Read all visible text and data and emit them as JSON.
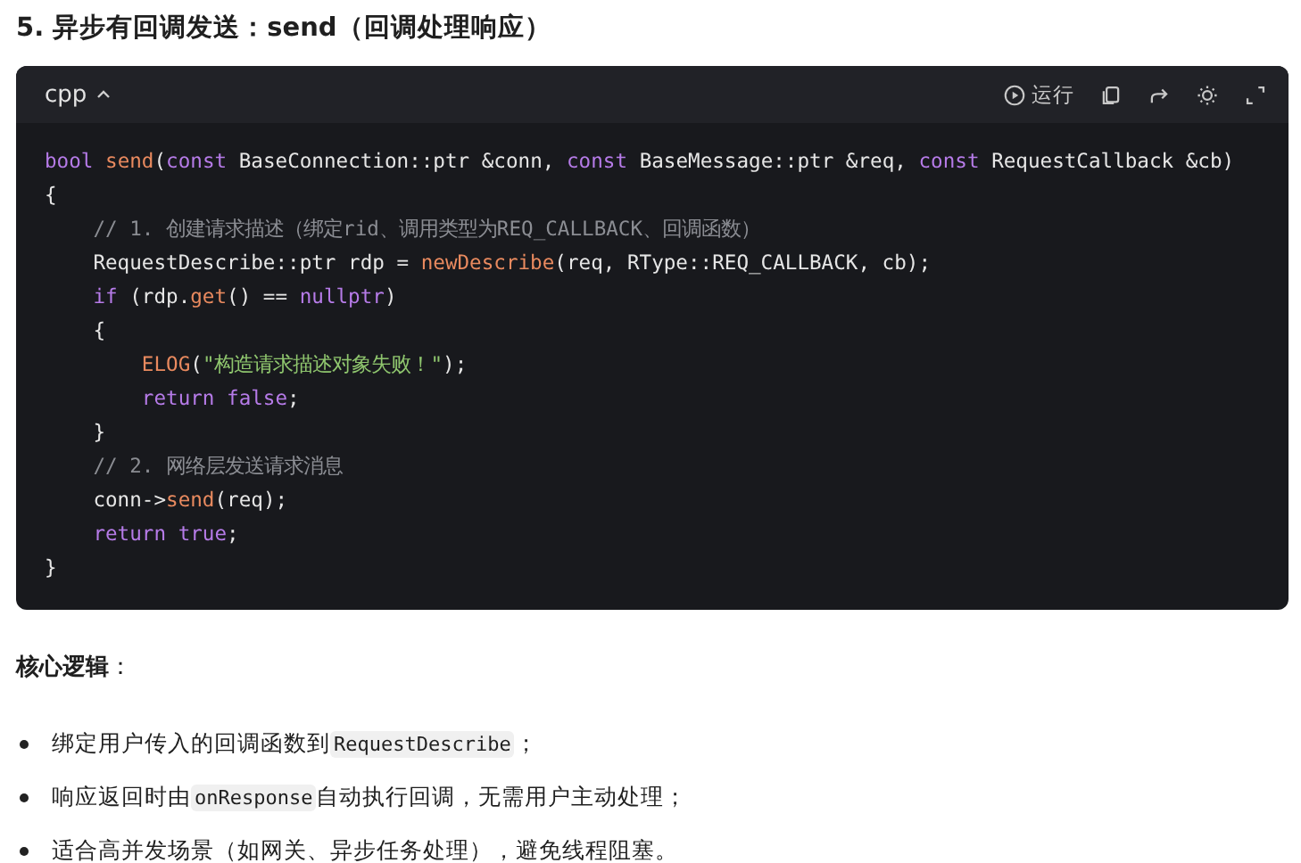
{
  "heading": "5. 异步有回调发送：send（回调处理响应）",
  "code_block": {
    "language": "cpp",
    "run_label": "运行",
    "lines": [
      [
        {
          "kind": "keyword",
          "text": "bool "
        },
        {
          "kind": "function",
          "text": "send"
        },
        {
          "kind": "plain",
          "text": "("
        },
        {
          "kind": "keyword",
          "text": "const "
        },
        {
          "kind": "plain",
          "text": "BaseConnection::ptr &conn, "
        },
        {
          "kind": "keyword",
          "text": "const "
        },
        {
          "kind": "plain",
          "text": "BaseMessage::ptr &req, "
        },
        {
          "kind": "keyword",
          "text": "const "
        },
        {
          "kind": "plain",
          "text": "RequestCallback &cb)"
        }
      ],
      [
        {
          "kind": "plain",
          "text": "{"
        }
      ],
      [
        {
          "kind": "comment",
          "text": "    // 1. 创建请求描述（绑定rid、调用类型为REQ_CALLBACK、回调函数）"
        }
      ],
      [
        {
          "kind": "plain",
          "text": "    RequestDescribe::ptr rdp = "
        },
        {
          "kind": "function",
          "text": "newDescribe"
        },
        {
          "kind": "plain",
          "text": "(req, RType::REQ_CALLBACK, cb);"
        }
      ],
      [
        {
          "kind": "keyword",
          "text": "    if "
        },
        {
          "kind": "plain",
          "text": "(rdp."
        },
        {
          "kind": "function",
          "text": "get"
        },
        {
          "kind": "plain",
          "text": "() == "
        },
        {
          "kind": "keyword",
          "text": "nullptr"
        },
        {
          "kind": "plain",
          "text": ")"
        }
      ],
      [
        {
          "kind": "plain",
          "text": "    {"
        }
      ],
      [
        {
          "kind": "function",
          "text": "        ELOG"
        },
        {
          "kind": "plain",
          "text": "("
        },
        {
          "kind": "string",
          "text": "\"构造请求描述对象失败！\""
        },
        {
          "kind": "plain",
          "text": ");"
        }
      ],
      [
        {
          "kind": "keyword",
          "text": "        return false"
        },
        {
          "kind": "plain",
          "text": ";"
        }
      ],
      [
        {
          "kind": "plain",
          "text": "    }"
        }
      ],
      [
        {
          "kind": "comment",
          "text": "    // 2. 网络层发送请求消息"
        }
      ],
      [
        {
          "kind": "plain",
          "text": "    conn->"
        },
        {
          "kind": "function",
          "text": "send"
        },
        {
          "kind": "plain",
          "text": "(req);"
        }
      ],
      [
        {
          "kind": "keyword",
          "text": "    return true"
        },
        {
          "kind": "plain",
          "text": ";"
        }
      ],
      [
        {
          "kind": "plain",
          "text": "}"
        }
      ]
    ]
  },
  "summary_label": {
    "strong": "核心逻辑",
    "rest": "："
  },
  "bullets": [
    [
      {
        "kind": "text",
        "text": "绑定用户传入的回调函数到"
      },
      {
        "kind": "code",
        "text": "RequestDescribe"
      },
      {
        "kind": "text",
        "text": "；"
      }
    ],
    [
      {
        "kind": "text",
        "text": "响应返回时由"
      },
      {
        "kind": "code",
        "text": "onResponse"
      },
      {
        "kind": "text",
        "text": "自动执行回调，无需用户主动处理；"
      }
    ],
    [
      {
        "kind": "text",
        "text": "适合高并发场景（如网关、异步任务处理），避免线程阻塞。"
      }
    ]
  ]
}
